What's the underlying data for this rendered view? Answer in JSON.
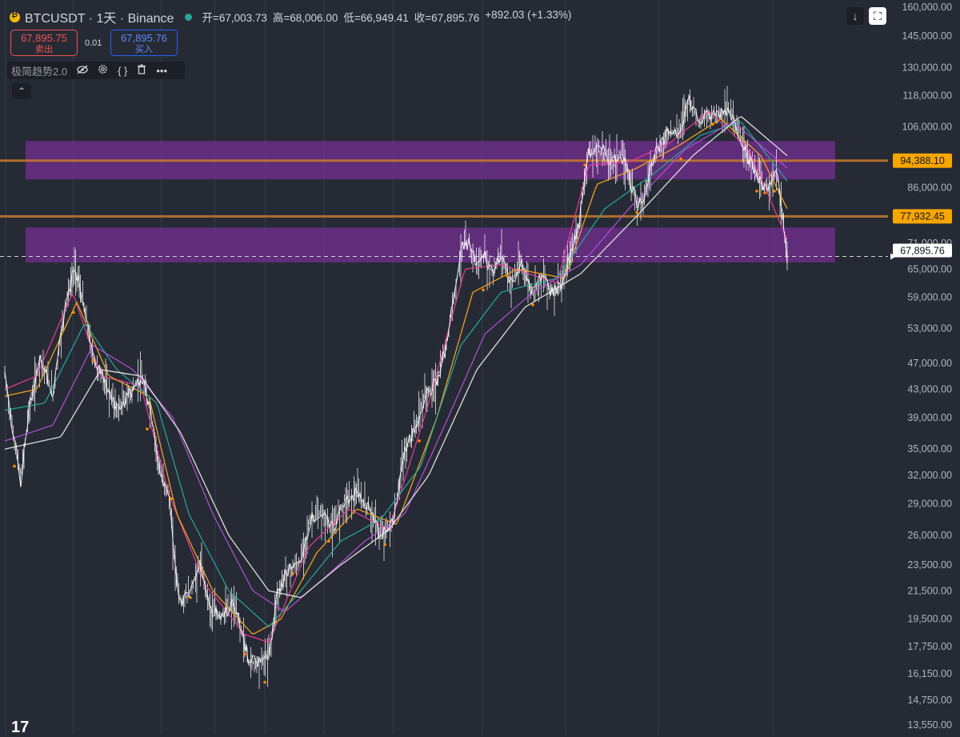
{
  "header": {
    "symbol_title": "BTCUSDT · 1天 · Binance",
    "open": "开=67,003.73",
    "high": "高=68,006.00",
    "low": "低=66,949.41",
    "close": "收=67,895.76",
    "change": "+892.03 (+1.33%)"
  },
  "trade": {
    "sell_price": "67,895.75",
    "sell_label": "卖出",
    "spread": "0.01",
    "buy_price": "67,895.76",
    "buy_label": "买入"
  },
  "indicator": {
    "name": "极简趋势2.0",
    "hide_icon": "eye-off-icon",
    "settings_icon": "gear-icon",
    "source_icon": "braces-icon",
    "delete_icon": "trash-icon",
    "more_icon": "more-icon"
  },
  "toolbar": {
    "collapse_glyph": "⌃",
    "download_glyph": "↓",
    "fullscreen_glyph": "⛶"
  },
  "logo": "17",
  "colors": {
    "background": "#262a34",
    "candles": "#ffffff",
    "zone": "#8e2fb2",
    "level_line": "#c77a2b",
    "level_label": "#f7a600",
    "ma_pink": "#e83a9b",
    "ma_orange": "#f5a623",
    "ma_green": "#26a69a",
    "ma_purple": "#b04fd6",
    "ma_white": "#e6e6e6",
    "signal_dot": "#ff8c00"
  },
  "chart_data": {
    "type": "line",
    "title": "BTCUSDT · 1天 · Binance",
    "y_scale": "log",
    "y_ticks": [
      160000,
      145000,
      130000,
      118000,
      106000,
      86000,
      71000,
      65000,
      59000,
      53000,
      47000,
      43000,
      39000,
      35000,
      32000,
      29000,
      26000,
      23500,
      21500,
      19500,
      17750,
      16150,
      14750,
      13550
    ],
    "y_tick_labels": [
      "160,000.00",
      "145,000.00",
      "130,000.00",
      "118,000.00",
      "106,000.00",
      "86,000.00",
      "71,000.00",
      "65,000.00",
      "59,000.00",
      "53,000.00",
      "47,000.00",
      "43,000.00",
      "39,000.00",
      "35,000.00",
      "32,000.00",
      "29,000.00",
      "26,000.00",
      "23,500.00",
      "21,500.00",
      "19,500.00",
      "17,750.00",
      "16,150.00",
      "14,750.00",
      "13,550.00"
    ],
    "horizontal_levels": [
      {
        "value": 94388.1,
        "label": "94,388.10"
      },
      {
        "value": 77932.45,
        "label": "77,932.45"
      }
    ],
    "current_price": {
      "value": 67895.76,
      "label": "67,895.76"
    },
    "zones": [
      {
        "low": 88500,
        "high": 101000
      },
      {
        "low": 66500,
        "high": 75000
      }
    ],
    "price_path": [
      [
        0,
        45000
      ],
      [
        12,
        36000
      ],
      [
        20,
        31500
      ],
      [
        30,
        40000
      ],
      [
        45,
        48000
      ],
      [
        60,
        42000
      ],
      [
        75,
        57000
      ],
      [
        88,
        65500
      ],
      [
        98,
        58000
      ],
      [
        110,
        48000
      ],
      [
        125,
        44000
      ],
      [
        140,
        40000
      ],
      [
        155,
        42000
      ],
      [
        170,
        45000
      ],
      [
        182,
        40000
      ],
      [
        195,
        32000
      ],
      [
        205,
        30000
      ],
      [
        212,
        24000
      ],
      [
        220,
        20500
      ],
      [
        232,
        21500
      ],
      [
        245,
        23500
      ],
      [
        258,
        20000
      ],
      [
        272,
        19800
      ],
      [
        285,
        20500
      ],
      [
        295,
        19000
      ],
      [
        305,
        16800
      ],
      [
        318,
        16800
      ],
      [
        330,
        17200
      ],
      [
        340,
        21000
      ],
      [
        352,
        23000
      ],
      [
        368,
        23500
      ],
      [
        382,
        27500
      ],
      [
        395,
        28000
      ],
      [
        410,
        26500
      ],
      [
        425,
        29500
      ],
      [
        440,
        30000
      ],
      [
        455,
        28500
      ],
      [
        470,
        26000
      ],
      [
        485,
        27000
      ],
      [
        498,
        34000
      ],
      [
        512,
        37500
      ],
      [
        525,
        42000
      ],
      [
        540,
        44000
      ],
      [
        552,
        50000
      ],
      [
        562,
        60000
      ],
      [
        572,
        70000
      ],
      [
        580,
        71000
      ],
      [
        590,
        66000
      ],
      [
        600,
        68000
      ],
      [
        610,
        64000
      ],
      [
        620,
        69000
      ],
      [
        632,
        62000
      ],
      [
        645,
        66000
      ],
      [
        660,
        60000
      ],
      [
        672,
        63500
      ],
      [
        685,
        60000
      ],
      [
        697,
        62000
      ],
      [
        708,
        69000
      ],
      [
        718,
        76000
      ],
      [
        728,
        96000
      ],
      [
        738,
        98000
      ],
      [
        750,
        97000
      ],
      [
        760,
        94000
      ],
      [
        770,
        97000
      ],
      [
        780,
        90000
      ],
      [
        790,
        82000
      ],
      [
        800,
        84000
      ],
      [
        810,
        95000
      ],
      [
        820,
        99000
      ],
      [
        832,
        105000
      ],
      [
        842,
        104000
      ],
      [
        855,
        117000
      ],
      [
        868,
        108000
      ],
      [
        880,
        110000
      ],
      [
        892,
        111000
      ],
      [
        905,
        113000
      ],
      [
        915,
        106000
      ],
      [
        925,
        99000
      ],
      [
        935,
        92000
      ],
      [
        948,
        86000
      ],
      [
        958,
        88000
      ],
      [
        965,
        90000
      ],
      [
        972,
        78000
      ],
      [
        978,
        67895.76
      ]
    ],
    "moving_averages": [
      {
        "color": "ma_pink",
        "values": [
          [
            0,
            43000
          ],
          [
            40,
            45000
          ],
          [
            85,
            60000
          ],
          [
            120,
            45000
          ],
          [
            170,
            43500
          ],
          [
            205,
            30000
          ],
          [
            250,
            22000
          ],
          [
            300,
            18500
          ],
          [
            330,
            18000
          ],
          [
            380,
            25000
          ],
          [
            430,
            28500
          ],
          [
            480,
            26500
          ],
          [
            530,
            41000
          ],
          [
            575,
            65000
          ],
          [
            620,
            66000
          ],
          [
            690,
            62000
          ],
          [
            730,
            93000
          ],
          [
            780,
            94000
          ],
          [
            830,
            100000
          ],
          [
            880,
            112000
          ],
          [
            930,
            98000
          ],
          [
            978,
            72000
          ]
        ]
      },
      {
        "color": "ma_orange",
        "values": [
          [
            0,
            42000
          ],
          [
            40,
            43000
          ],
          [
            90,
            58000
          ],
          [
            130,
            45000
          ],
          [
            180,
            42000
          ],
          [
            215,
            28000
          ],
          [
            260,
            21500
          ],
          [
            310,
            18500
          ],
          [
            345,
            19500
          ],
          [
            390,
            24500
          ],
          [
            440,
            28500
          ],
          [
            490,
            27000
          ],
          [
            540,
            39000
          ],
          [
            585,
            60000
          ],
          [
            640,
            65000
          ],
          [
            700,
            63000
          ],
          [
            740,
            87000
          ],
          [
            790,
            92000
          ],
          [
            840,
            99000
          ],
          [
            895,
            109000
          ],
          [
            945,
            96000
          ],
          [
            978,
            80000
          ]
        ]
      },
      {
        "color": "ma_green",
        "values": [
          [
            0,
            40000
          ],
          [
            50,
            41000
          ],
          [
            100,
            54000
          ],
          [
            140,
            46000
          ],
          [
            190,
            41000
          ],
          [
            230,
            28000
          ],
          [
            280,
            21500
          ],
          [
            330,
            19000
          ],
          [
            370,
            21500
          ],
          [
            420,
            25500
          ],
          [
            470,
            27500
          ],
          [
            520,
            33000
          ],
          [
            570,
            50000
          ],
          [
            620,
            60000
          ],
          [
            690,
            63000
          ],
          [
            750,
            80000
          ],
          [
            810,
            90000
          ],
          [
            870,
            103000
          ],
          [
            920,
            108000
          ],
          [
            978,
            88000
          ]
        ]
      },
      {
        "color": "ma_purple",
        "values": [
          [
            0,
            36000
          ],
          [
            60,
            38000
          ],
          [
            110,
            50000
          ],
          [
            160,
            46000
          ],
          [
            210,
            39000
          ],
          [
            260,
            28000
          ],
          [
            310,
            21500
          ],
          [
            350,
            20000
          ],
          [
            400,
            22500
          ],
          [
            450,
            25500
          ],
          [
            500,
            28000
          ],
          [
            550,
            38000
          ],
          [
            600,
            52000
          ],
          [
            660,
            60000
          ],
          [
            720,
            66000
          ],
          [
            780,
            80000
          ],
          [
            850,
            98000
          ],
          [
            910,
            108000
          ],
          [
            978,
            92000
          ]
        ]
      },
      {
        "color": "ma_white",
        "values": [
          [
            0,
            35000
          ],
          [
            70,
            36500
          ],
          [
            120,
            46000
          ],
          [
            170,
            45000
          ],
          [
            220,
            37000
          ],
          [
            280,
            26000
          ],
          [
            330,
            21500
          ],
          [
            370,
            21000
          ],
          [
            420,
            23500
          ],
          [
            480,
            26500
          ],
          [
            530,
            32000
          ],
          [
            590,
            46000
          ],
          [
            650,
            57000
          ],
          [
            720,
            64000
          ],
          [
            790,
            78000
          ],
          [
            860,
            96000
          ],
          [
            920,
            110000
          ],
          [
            978,
            96000
          ]
        ]
      }
    ]
  }
}
